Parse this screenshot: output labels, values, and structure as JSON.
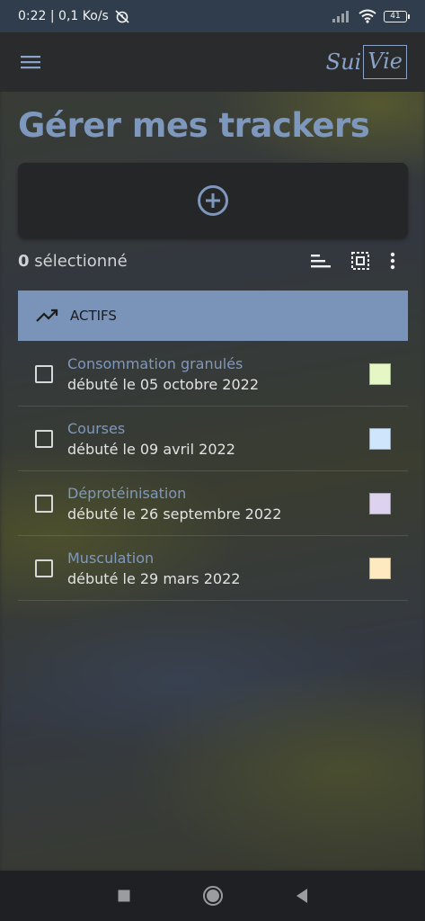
{
  "status_bar": {
    "time_speed": "0:22 | 0,1 Ko/s",
    "battery": "41"
  },
  "app_bar": {
    "menu_icon": "hamburger-menu-icon",
    "logo_part1": "Sui",
    "logo_part2": "Vie"
  },
  "page": {
    "title": "Gérer mes trackers"
  },
  "add_card": {
    "icon": "add-circle-icon"
  },
  "selection": {
    "count": "0",
    "label": " sélectionné"
  },
  "section": {
    "icon": "trending-up-icon",
    "label": "ACTIFS"
  },
  "trackers": [
    {
      "name": "Consommation granulés",
      "date": "débuté le 05 octobre 2022",
      "color": "#e4f7c4"
    },
    {
      "name": "Courses",
      "date": "débuté le 09 avril 2022",
      "color": "#cfe5fb"
    },
    {
      "name": "Déprotéinisation",
      "date": "débuté le 26 septembre 2022",
      "color": "#ddd3ef"
    },
    {
      "name": "Musculation",
      "date": "débuté le 29 mars 2022",
      "color": "#fdeac0"
    }
  ],
  "colors": {
    "accent": "#7e97bd",
    "section_bg": "#7a93b9"
  }
}
